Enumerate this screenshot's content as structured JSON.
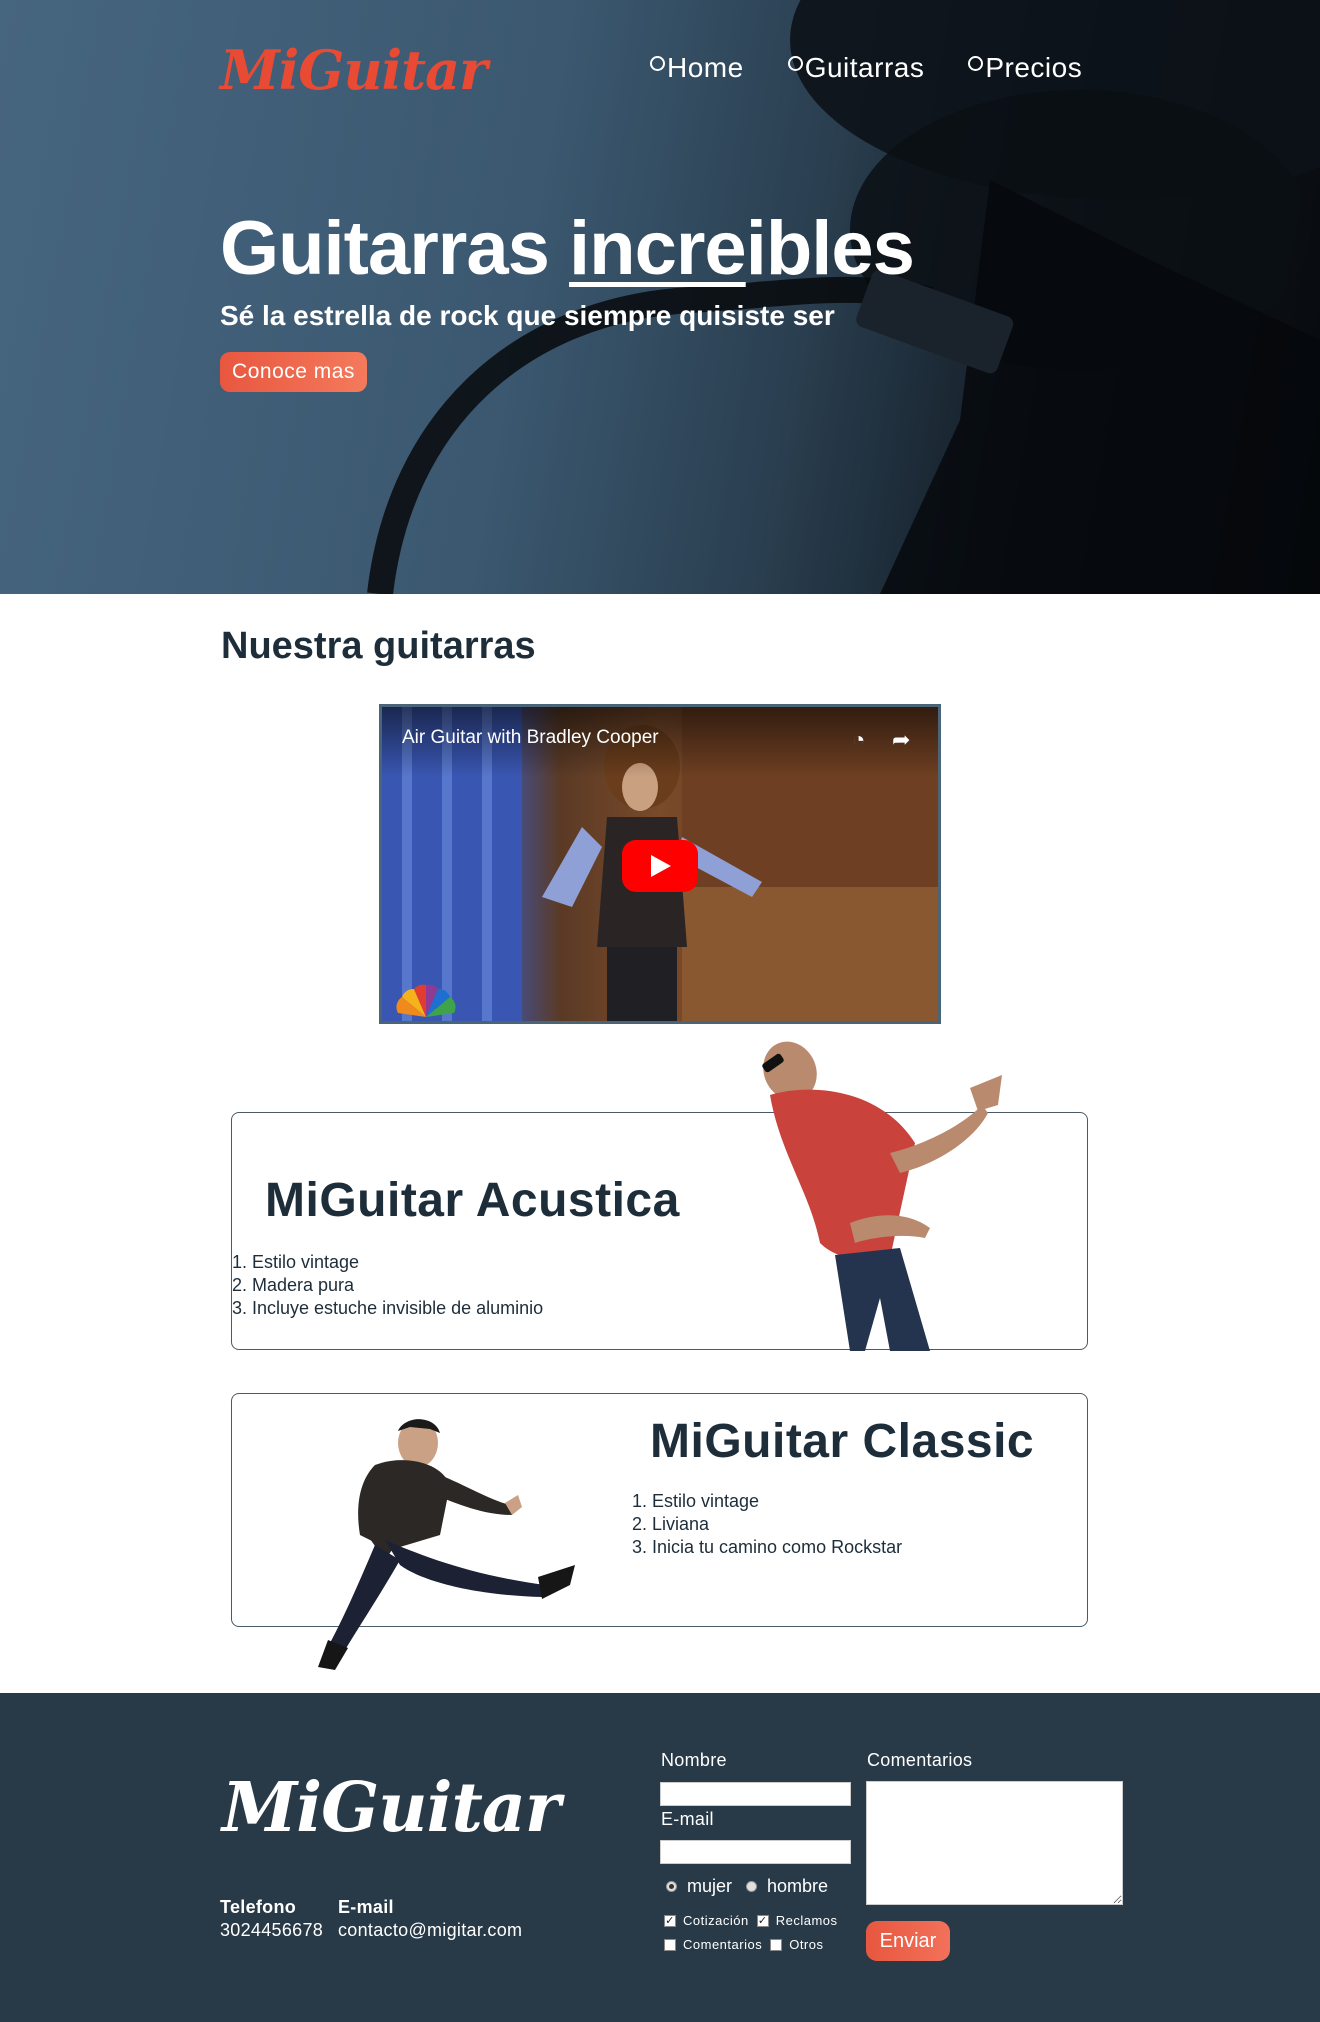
{
  "header": {
    "logo": "MiGuitar",
    "nav": [
      {
        "label": "Home"
      },
      {
        "label": "Guitarras"
      },
      {
        "label": "Precios"
      }
    ]
  },
  "hero": {
    "title_plain": "Guitarras ",
    "title_underlined": "incre",
    "title_rest": "ibles",
    "subtitle": "Sé la estrella de rock que siempre quisiste ser",
    "cta_label": "Conoce mas"
  },
  "main": {
    "section_title": "Nuestra guitarras",
    "video": {
      "title": "Air Guitar with Bradley Cooper",
      "icons": [
        "clock-icon",
        "share-icon",
        "play-icon",
        "nbc-peacock-logo"
      ]
    },
    "products": [
      {
        "title": "MiGuitar Acustica",
        "features": [
          "Estilo vintage",
          "Madera pura",
          "Incluye estuche invisible de aluminio"
        ]
      },
      {
        "title": "MiGuitar Classic",
        "features": [
          "Estilo vintage",
          "Liviana",
          "Inicia tu camino como Rockstar"
        ]
      }
    ]
  },
  "footer": {
    "logo": "MiGuitar",
    "phone_label": "Telefono",
    "phone_value": "3024456678",
    "email_label": "E-mail",
    "email_value": "contacto@migitar.com",
    "form": {
      "name_label": "Nombre",
      "name_value": "",
      "email_label": "E-mail",
      "email_value": "",
      "comments_label": "Comentarios",
      "comments_value": "",
      "gender_options": [
        {
          "label": "mujer",
          "checked": true
        },
        {
          "label": "hombre",
          "checked": false
        }
      ],
      "topics": [
        {
          "label": "Cotización",
          "checked": true
        },
        {
          "label": "Reclamos",
          "checked": true
        },
        {
          "label": "Comentarios",
          "checked": false
        },
        {
          "label": "Otros",
          "checked": false
        }
      ],
      "submit_label": "Enviar"
    }
  },
  "colors": {
    "accent": "#e8573f",
    "dark": "#1d2d3a",
    "footer_bg": "#283947",
    "hero_bg": "#3b5870"
  }
}
